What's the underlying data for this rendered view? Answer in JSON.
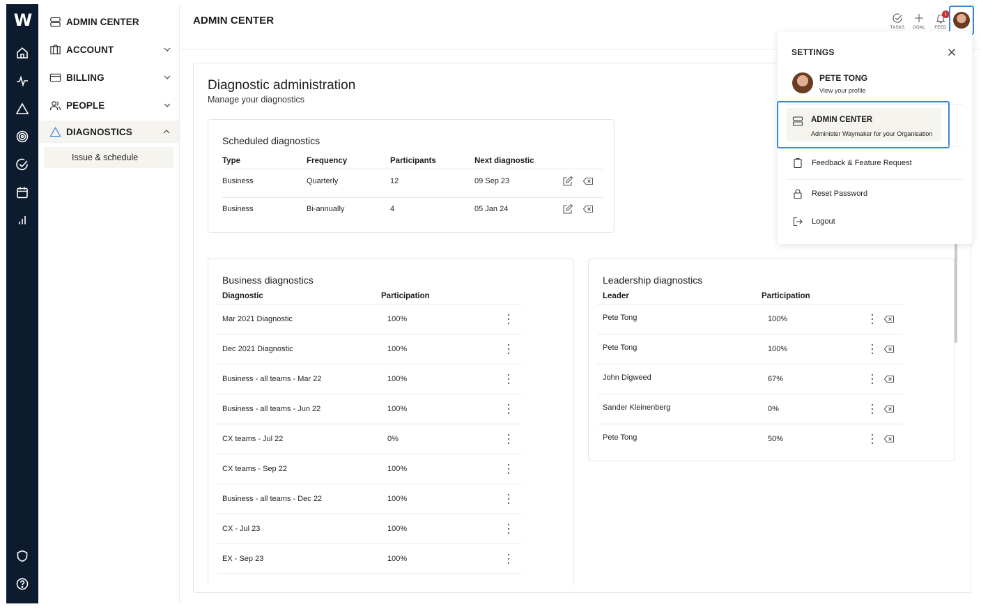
{
  "app": {
    "logo": "W",
    "header_title": "ADMIN CENTER"
  },
  "rail": {
    "icons": [
      "home-icon",
      "pulse-icon",
      "triangle-icon",
      "target-icon",
      "check-circle-icon",
      "calendar-icon",
      "bar-chart-icon",
      "shield-icon",
      "help-icon"
    ]
  },
  "sidebar": {
    "items": [
      {
        "label": "ADMIN CENTER",
        "icon": "server-icon"
      },
      {
        "label": "ACCOUNT",
        "icon": "building-icon"
      },
      {
        "label": "BILLING",
        "icon": "card-icon"
      },
      {
        "label": "PEOPLE",
        "icon": "people-icon"
      },
      {
        "label": "DIAGNOSTICS",
        "icon": "triangle-icon"
      }
    ],
    "sub_item": "Issue & schedule"
  },
  "header_actions": {
    "tasks": "TASKS",
    "goal": "GOAL",
    "feed": "FEED",
    "feed_badge": "1"
  },
  "page": {
    "title": "Diagnostic administration",
    "subtitle": "Manage your diagnostics"
  },
  "scheduled": {
    "title": "Scheduled diagnostics",
    "columns": [
      "Type",
      "Frequency",
      "Participants",
      "Next diagnostic"
    ],
    "rows": [
      {
        "type": "Business",
        "frequency": "Quarterly",
        "participants": "12",
        "next": "09 Sep 23"
      },
      {
        "type": "Business",
        "frequency": "Bi-annually",
        "participants": "4",
        "next": "05 Jan 24"
      }
    ]
  },
  "business": {
    "title": "Business diagnostics",
    "columns": [
      "Diagnostic",
      "Participation"
    ],
    "rows": [
      {
        "name": "Mar 2021 Diagnostic",
        "participation": "100%"
      },
      {
        "name": "Dec 2021 Diagnostic",
        "participation": "100%"
      },
      {
        "name": "Business - all teams - Mar 22",
        "participation": "100%"
      },
      {
        "name": "Business - all teams - Jun 22",
        "participation": "100%"
      },
      {
        "name": "CX teams - Jul 22",
        "participation": "0%"
      },
      {
        "name": "CX teams - Sep 22",
        "participation": "100%"
      },
      {
        "name": "Business - all teams - Dec 22",
        "participation": "100%"
      },
      {
        "name": "CX - Jul 23",
        "participation": "100%"
      },
      {
        "name": "EX - Sep 23",
        "participation": "100%"
      }
    ]
  },
  "leadership": {
    "title": "Leadership diagnostics",
    "columns": [
      "Leader",
      "Participation"
    ],
    "rows": [
      {
        "name": "Pete Tong",
        "participation": "100%"
      },
      {
        "name": "Pete Tong",
        "participation": "100%"
      },
      {
        "name": "John Digweed",
        "participation": "67%"
      },
      {
        "name": "Sander Kleinenberg",
        "participation": "0%"
      },
      {
        "name": "Pete Tong",
        "participation": "50%"
      }
    ]
  },
  "settings": {
    "title": "SETTINGS",
    "profile_name": "PETE TONG",
    "profile_sub": "View your profile",
    "admin_title": "ADMIN CENTER",
    "admin_sub": "Administer Waymaker for your Organisation",
    "feedback": "Feedback & Feature Request",
    "reset": "Reset Password",
    "logout": "Logout"
  },
  "colors": {
    "rail": "#0d1b2e",
    "highlight": "#3a86d6",
    "active_bg": "#f6f4ef",
    "badge": "#c8322f"
  }
}
